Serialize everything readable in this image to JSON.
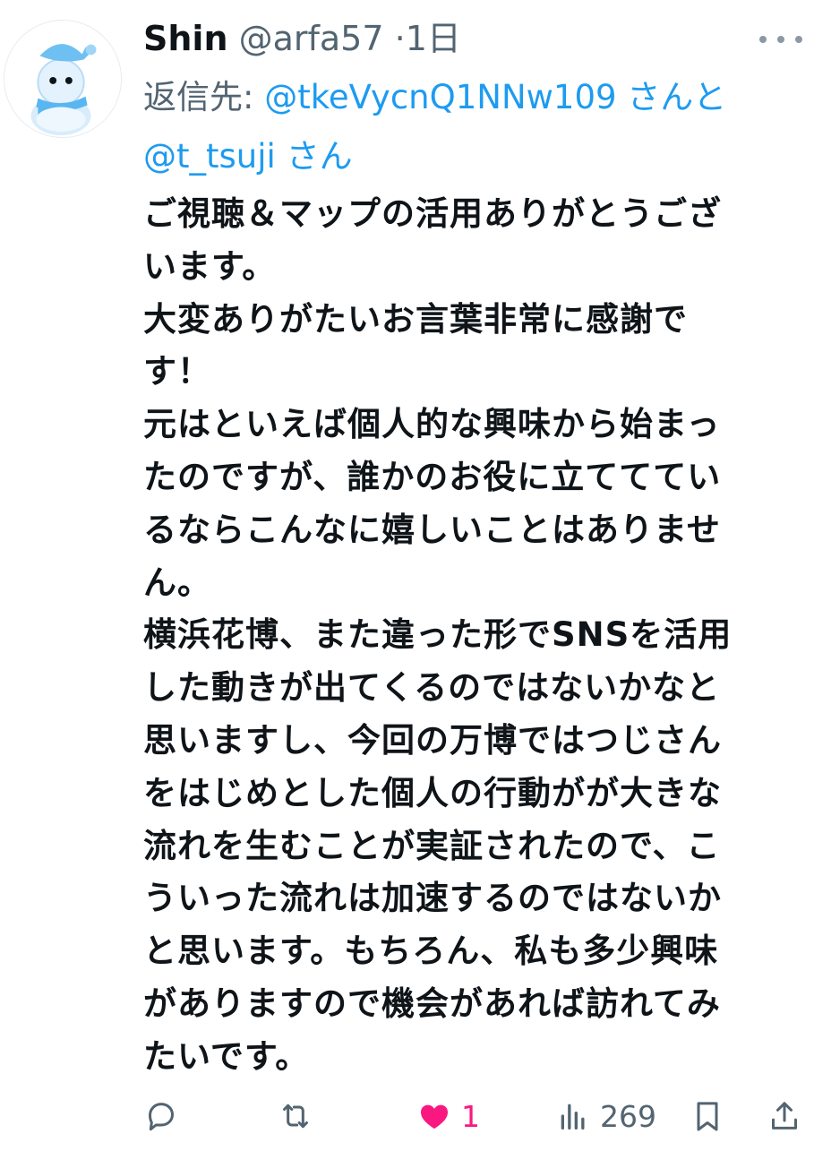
{
  "author": {
    "name": "Shin",
    "handle": "@arfa57",
    "separator": "·",
    "time": "1日"
  },
  "reply": {
    "prefix": "返信先: ",
    "mention1": "@tkeVycnQ1NNw109",
    "joiner": " さんと",
    "mention2": "@t_tsuji",
    "suffix": " さん"
  },
  "body_lines": [
    "ご視聴＆マップの活用ありがとうござ",
    "います。",
    "大変ありがたいお言葉非常に感謝で",
    "す！",
    "元はといえば個人的な興味から始まっ",
    "たのですが、誰かのお役に立てててい",
    "るならこんなに嬉しいことはありませ",
    "ん。",
    "横浜花博、また違った形でSNSを活用",
    "した動きが出てくるのではないかなと",
    "思いますし、今回の万博ではつじさん",
    "をはじめとした個人の行動がが大きな",
    "流れを生むことが実証されたので、こ",
    "ういった流れは加速するのではないか",
    "と思います。もちろん、私も多少興味",
    "がありますので機会があれば訪れてみ",
    "たいです。"
  ],
  "actions": {
    "reply_icon": "reply-icon",
    "repost_icon": "repost-icon",
    "like_icon": "heart-filled-icon",
    "like_count": "1",
    "views_icon": "views-icon",
    "views_count": "269",
    "bookmark_icon": "bookmark-icon",
    "share_icon": "share-icon"
  },
  "colors": {
    "accent": "#1d9bf0",
    "like": "#f91880",
    "muted": "#536471",
    "text": "#0f1419"
  }
}
